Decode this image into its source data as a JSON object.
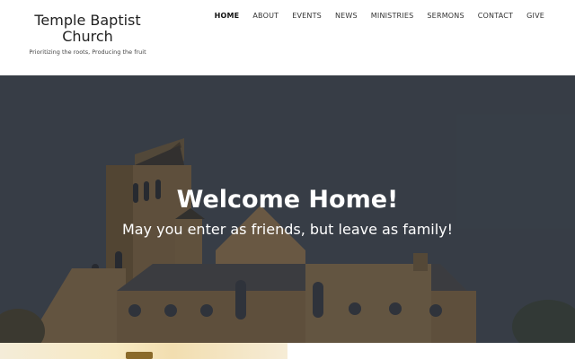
{
  "site": {
    "title": "Temple Baptist Church",
    "tagline": "Prioritizing the roots, Producing the fruit"
  },
  "nav": {
    "items": [
      "HOME",
      "ABOUT",
      "EVENTS",
      "NEWS",
      "MINISTRIES",
      "SERMONS",
      "CONTACT",
      "GIVE"
    ],
    "active": "HOME"
  },
  "hero": {
    "title": "Welcome Home!",
    "subtitle": "May you enter as friends, but leave as family!"
  },
  "colors": {
    "hero_text": "#ffffff",
    "nav_text": "#333333",
    "header_bg": "#ffffff"
  }
}
